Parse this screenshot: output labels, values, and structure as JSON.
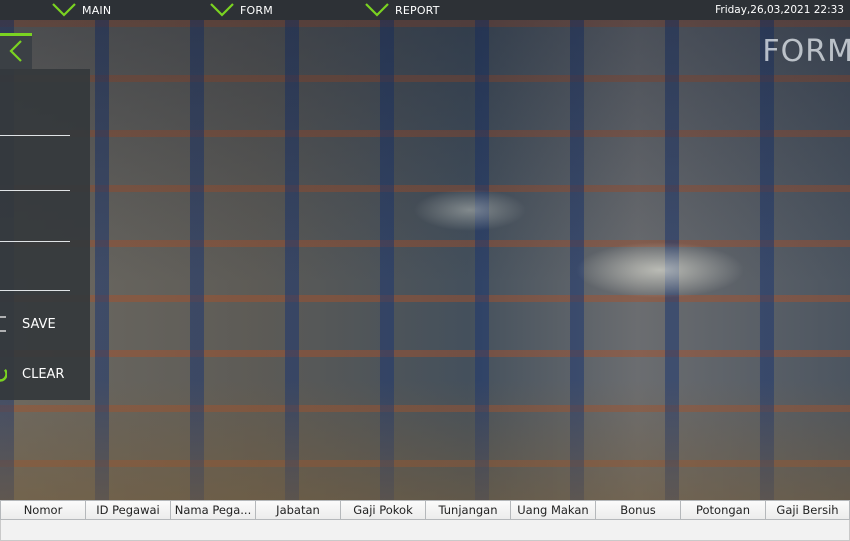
{
  "topbar": {
    "nav": [
      {
        "label": "MAIN"
      },
      {
        "label": "FORM"
      },
      {
        "label": "REPORT"
      }
    ],
    "datetime": "Friday,26,03,2021  22:33",
    "accent": "#7ad321",
    "bg_color": "#2d3136"
  },
  "watermark": "FORM",
  "panel": {
    "back_icon": "chevron-left-icon",
    "buttons": [
      {
        "label": "SAVE",
        "icon": "save-icon"
      },
      {
        "label": "CLEAR",
        "icon": "clear-icon"
      }
    ]
  },
  "table": {
    "columns": [
      "Nomor",
      "ID Pegawai",
      "Nama Pega...",
      "Jabatan",
      "Gaji Pokok",
      "Tunjangan",
      "Uang Makan",
      "Bonus",
      "Potongan",
      "Gaji Bersih"
    ],
    "rows": []
  }
}
